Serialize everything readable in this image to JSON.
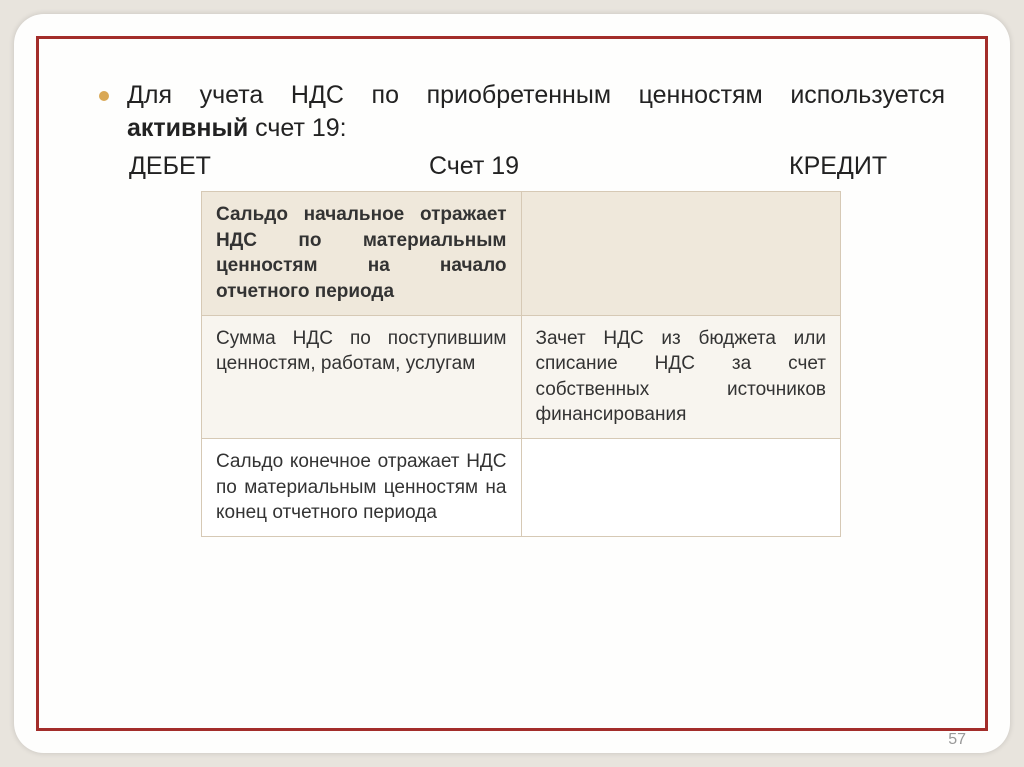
{
  "intro": {
    "before": "Для учета НДС по приобретенным ценностям используется ",
    "bold": "активный",
    "after": " счет 19:"
  },
  "headers": {
    "debit": "ДЕБЕТ",
    "account": "Счет 19",
    "credit": "КРЕДИТ"
  },
  "table": {
    "r1c1": "Сальдо начальное отража­ет НДС по материальным ценностям на начало отчетного периода",
    "r1c2": "",
    "r2c1": "Сумма НДС по поступившим ценностям, работам, услугам",
    "r2c2": "Зачет НДС из бюджета или списание НДС за счет собственных источников финансирования",
    "r3c1": "Сальдо конечное отражает НДС по материальным ценностям на конец отчетного периода",
    "r3c2": ""
  },
  "pageNumber": "57"
}
